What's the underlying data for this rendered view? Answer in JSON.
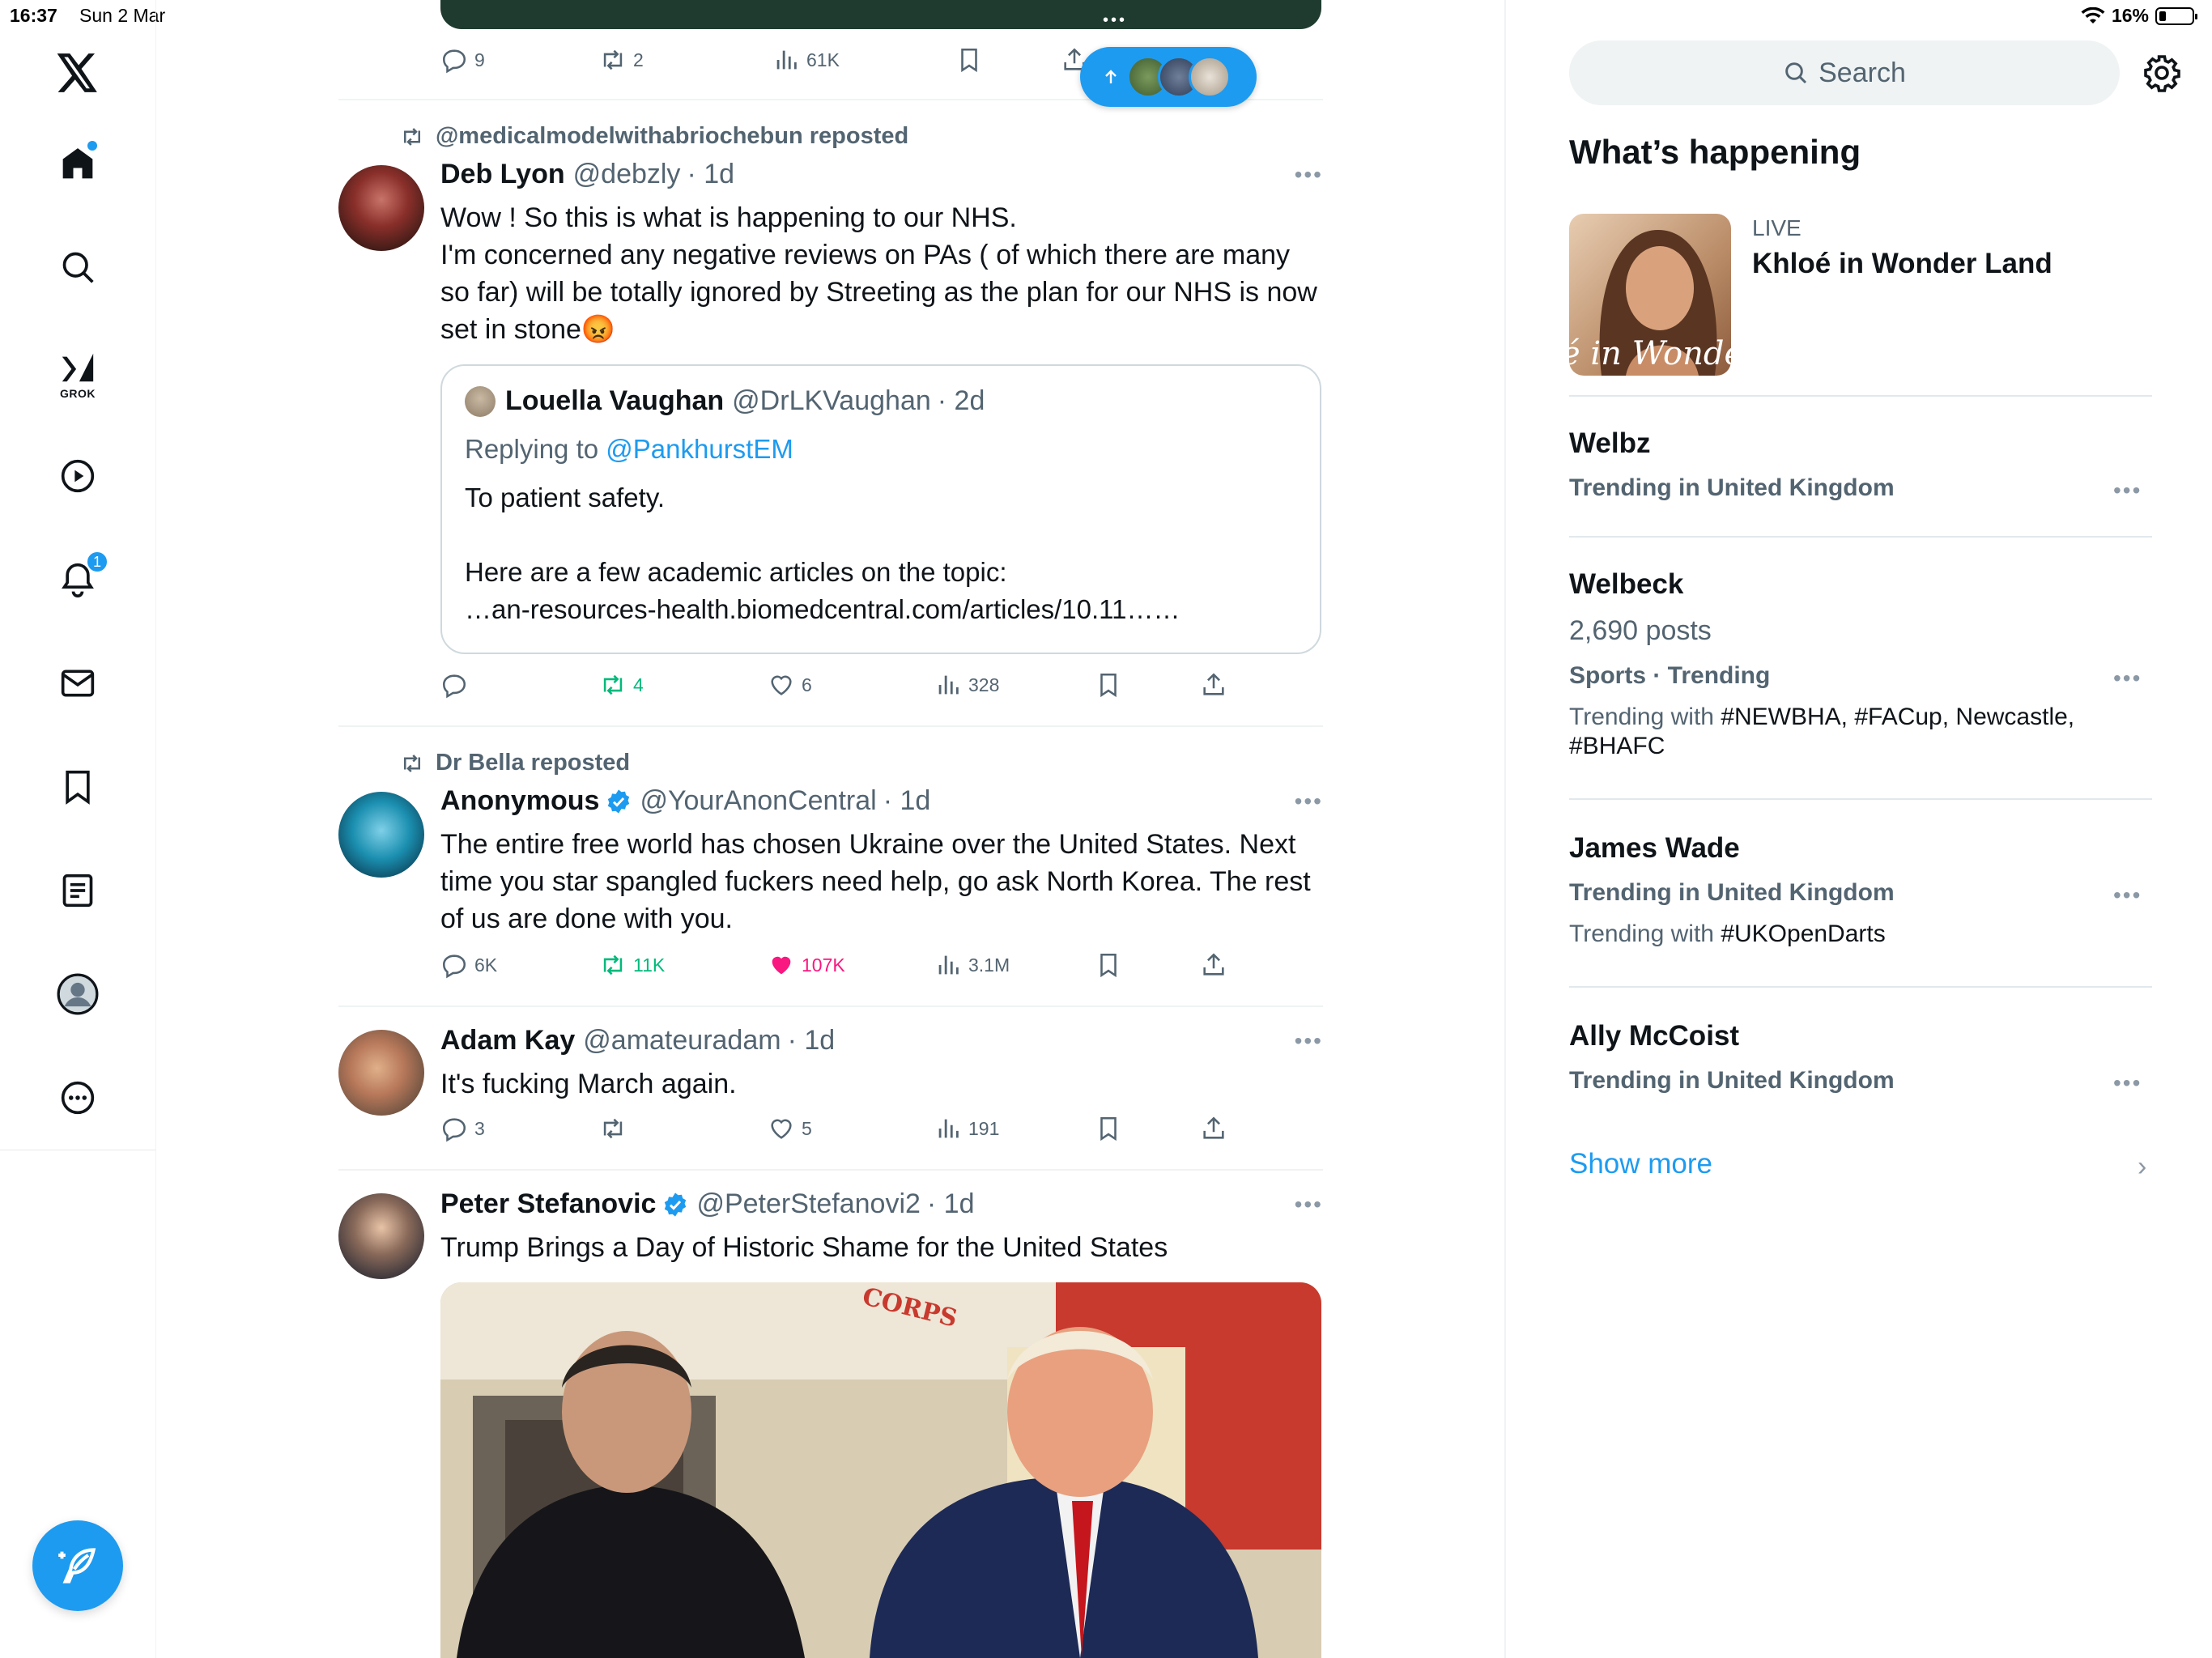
{
  "status_bar": {
    "time": "16:37",
    "date": "Sun 2 Mar",
    "battery": "16%"
  },
  "nav": {
    "items": [
      "home",
      "explore",
      "grok",
      "videos",
      "notifications",
      "messages",
      "bookmarks",
      "lists",
      "profile",
      "more"
    ],
    "grok_label": "GROK",
    "notifications_badge": "1"
  },
  "top_post": {
    "replies": "9",
    "reposts": "2",
    "views": "61K"
  },
  "post1": {
    "repost_by": "@medicalmodelwithabriochebun reposted",
    "name": "Deb Lyon",
    "handle": "@debzly",
    "time": "· 1d",
    "text": "Wow ! So this is what is happening to our NHS.\nI'm concerned any negative reviews on PAs ( of which there are many so far) will be totally ignored by Streeting as the plan for our NHS is now set in stone😡",
    "quote": {
      "name": "Louella Vaughan",
      "handle": "@DrLKVaughan",
      "time": "· 2d",
      "replying_prefix": "Replying to ",
      "replying_to": "@PankhurstEM",
      "text": "To patient safety.\n\nHere are a few academic articles on the topic:\n…an-resources-health.biomedcentral.com/articles/10.11……"
    },
    "replies": "",
    "reposts": "4",
    "likes": "6",
    "views": "328"
  },
  "post2": {
    "repost_by": "Dr Bella reposted",
    "name": "Anonymous",
    "handle": "@YourAnonCentral",
    "time": "· 1d",
    "text": "The entire free world has chosen Ukraine over the United States. Next time you star spangled fuckers need help, go ask North Korea. The rest of us are done with you.",
    "replies": "6K",
    "reposts": "11K",
    "likes": "107K",
    "views": "3.1M"
  },
  "post3": {
    "name": "Adam Kay",
    "handle": "@amateuradam",
    "time": "· 1d",
    "text": "It's fucking March again.",
    "replies": "3",
    "reposts": "",
    "likes": "5",
    "views": "191"
  },
  "post4": {
    "name": "Peter Stefanovic",
    "handle": "@PeterStefanovi2",
    "time": "· 1d",
    "text": "Trump Brings a Day of Historic Shame for the United States",
    "image_caption": "CORPS"
  },
  "sidebar": {
    "search_placeholder": "Search",
    "whats_happening": "What’s happening",
    "live": {
      "label": "LIVE",
      "title": "Khloé in Wonder Land",
      "image_text": "é in Wonder L"
    },
    "trends": [
      {
        "name": "Welbz",
        "meta": "Trending in United Kingdom"
      },
      {
        "name": "Welbeck",
        "posts": "2,690 posts",
        "meta": "Sports · Trending",
        "with_prefix": "Trending with ",
        "with_tags": "#NEWBHA, #FACup, Newcastle, #BHAFC"
      },
      {
        "name": "James Wade",
        "meta": "Trending in United Kingdom",
        "with_prefix": "Trending with ",
        "with_tags": "#UKOpenDarts"
      },
      {
        "name": "Ally McCoist",
        "meta": "Trending in United Kingdom"
      }
    ],
    "show_more": "Show more"
  },
  "colors": {
    "accent": "#1d9bf0",
    "repost_green": "#00ba7c",
    "like_pink": "#f91880",
    "muted": "#536471"
  }
}
